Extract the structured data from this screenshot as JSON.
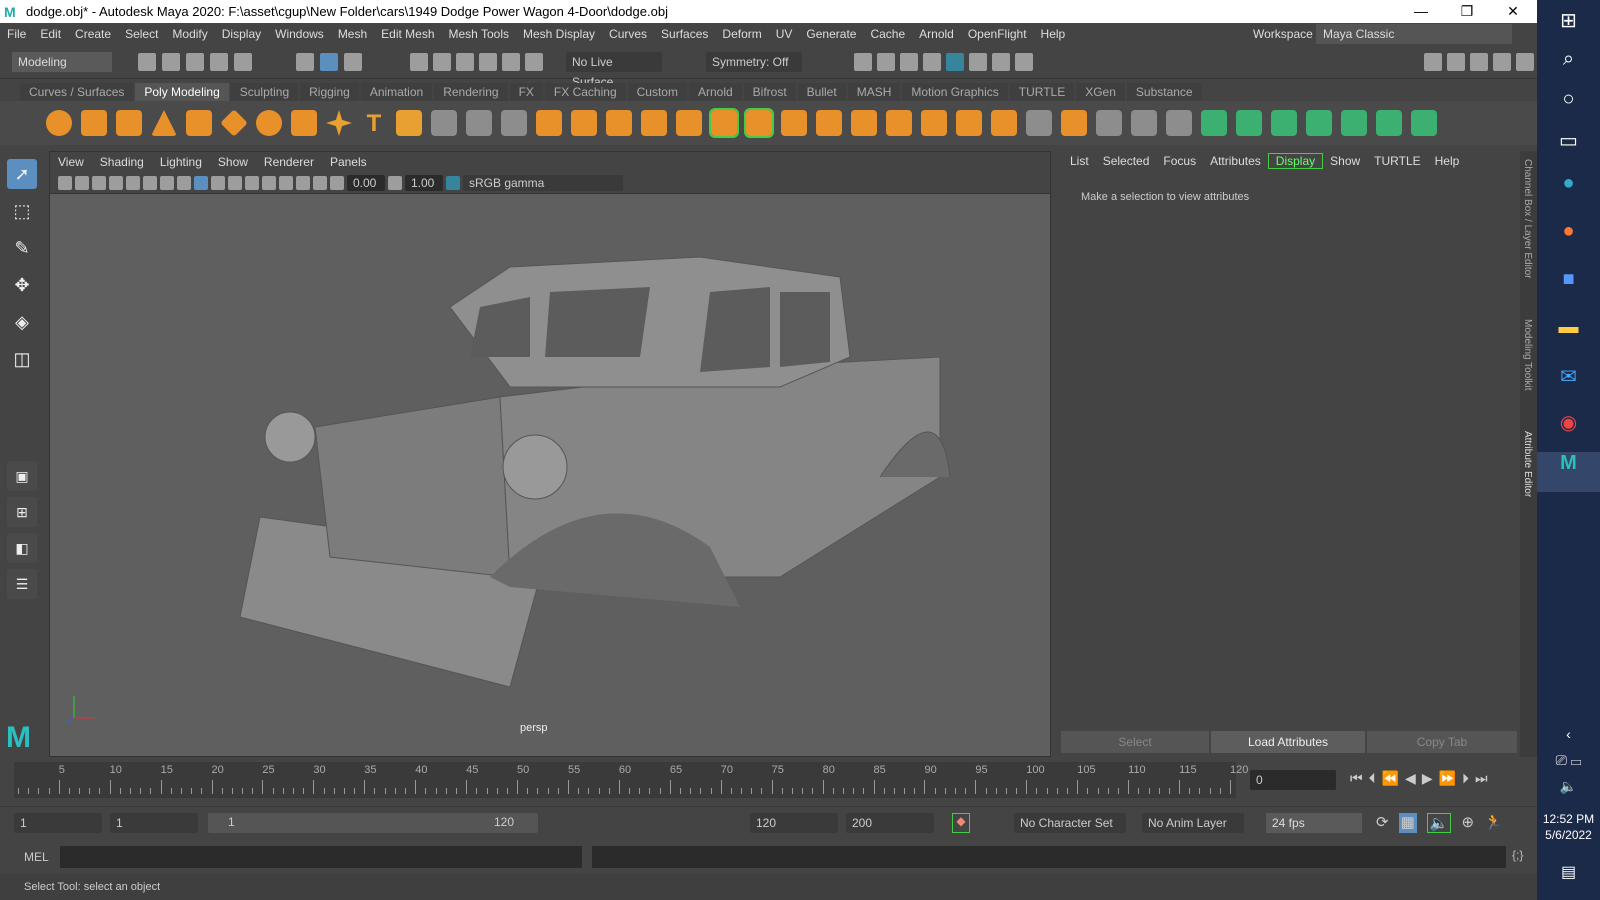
{
  "window": {
    "title": "dodge.obj* - Autodesk Maya 2020: F:\\asset\\cgup\\New Folder\\cars\\1949 Dodge Power Wagon 4-Door\\dodge.obj",
    "logo": "M",
    "minimize": "—",
    "restore": "❐",
    "close": "✕"
  },
  "menu": [
    "File",
    "Edit",
    "Create",
    "Select",
    "Modify",
    "Display",
    "Windows",
    "Mesh",
    "Edit Mesh",
    "Mesh Tools",
    "Mesh Display",
    "Curves",
    "Surfaces",
    "Deform",
    "UV",
    "Generate",
    "Cache",
    "Arnold",
    "OpenFlight",
    "Help"
  ],
  "status": {
    "menu_set": "Modeling",
    "live_surface": "No Live Surface",
    "symmetry": "Symmetry: Off",
    "workspace_label": "Workspace :",
    "workspace": "Maya Classic"
  },
  "shelf_tabs": [
    "Curves / Surfaces",
    "Poly Modeling",
    "Sculpting",
    "Rigging",
    "Animation",
    "Rendering",
    "FX",
    "FX Caching",
    "Custom",
    "Arnold",
    "Bifrost",
    "Bullet",
    "MASH",
    "Motion Graphics",
    "TURTLE",
    "XGen",
    "Substance"
  ],
  "active_shelf": "Poly Modeling",
  "viewport": {
    "menu": [
      "View",
      "Shading",
      "Lighting",
      "Show",
      "Renderer",
      "Panels"
    ],
    "exposure": "0.00",
    "gamma": "1.00",
    "color_space": "sRGB gamma",
    "camera": "persp"
  },
  "attr_editor": {
    "menu": [
      "List",
      "Selected",
      "Focus",
      "Attributes",
      "Display",
      "Show",
      "TURTLE",
      "Help"
    ],
    "message": "Make a selection to view attributes",
    "buttons": {
      "select": "Select",
      "load": "Load Attributes",
      "copy": "Copy Tab"
    }
  },
  "side_tabs": [
    "Channel Box / Layer Editor",
    "Modeling Toolkit",
    "Attribute Editor"
  ],
  "timeline": {
    "ticks": [
      "5",
      "10",
      "15",
      "20",
      "25",
      "30",
      "35",
      "40",
      "45",
      "50",
      "55",
      "60",
      "65",
      "70",
      "75",
      "80",
      "85",
      "90",
      "95",
      "100",
      "105",
      "110",
      "115",
      "120"
    ],
    "current_frame": "0"
  },
  "range": {
    "start": "1",
    "anim_start": "1",
    "slider_start": "1",
    "slider_end": "120",
    "end": "120",
    "anim_end": "200",
    "character_set": "No Character Set",
    "anim_layer": "No Anim Layer",
    "fps": "24 fps"
  },
  "command": {
    "label": "MEL"
  },
  "help_line": "Select Tool: select an object",
  "taskbar": {
    "time": "12:52 PM",
    "date": "5/6/2022"
  }
}
